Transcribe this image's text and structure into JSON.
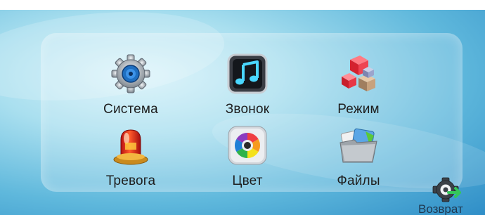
{
  "menu": {
    "items": [
      {
        "label": "Система",
        "icon": "gear-icon"
      },
      {
        "label": "Звонок",
        "icon": "music-note-icon"
      },
      {
        "label": "Режим",
        "icon": "cubes-icon"
      },
      {
        "label": "Тревога",
        "icon": "alarm-siren-icon"
      },
      {
        "label": "Цвет",
        "icon": "color-wheel-icon"
      },
      {
        "label": "Файлы",
        "icon": "folder-icon"
      }
    ]
  },
  "back": {
    "label": "Возврат",
    "icon": "gear-back-arrow-icon"
  },
  "colors": {
    "background": "#5fb8dc",
    "panel": "rgba(255,255,255,0.20)",
    "label_text": "#1e1e1e"
  }
}
